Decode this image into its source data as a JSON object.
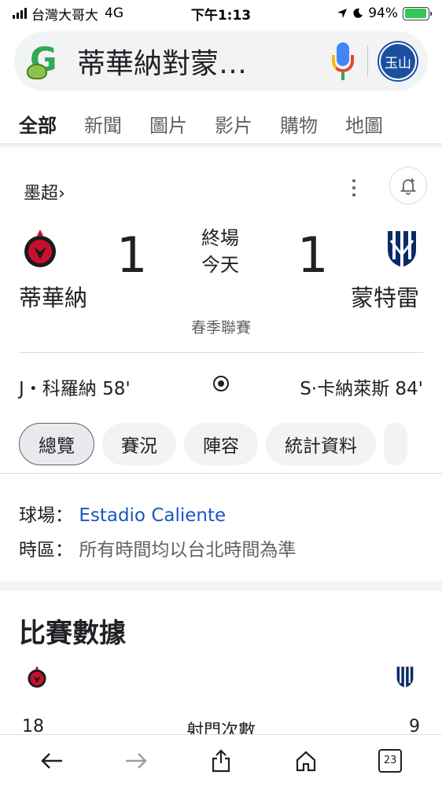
{
  "status_bar": {
    "carrier": "台灣大哥大",
    "network": "4G",
    "time": "下午1:13",
    "battery": "94%",
    "battery_level": 0.94
  },
  "search": {
    "query": "蒂華納對蒙…",
    "avatar_label": "玉山"
  },
  "tabs": [
    {
      "label": "全部",
      "active": true
    },
    {
      "label": "新聞"
    },
    {
      "label": "圖片"
    },
    {
      "label": "影片"
    },
    {
      "label": "購物"
    },
    {
      "label": "地圖"
    }
  ],
  "match": {
    "league": "墨超",
    "home": {
      "name": "蒂華納",
      "score": "1"
    },
    "away": {
      "name": "蒙特雷",
      "score": "1"
    },
    "status": "終場",
    "date": "今天",
    "season": "春季聯賽",
    "home_scorer": "J・科羅納 58'",
    "away_scorer": "S·卡納萊斯 84'"
  },
  "chips": [
    "總覽",
    "賽況",
    "陣容",
    "統計資料"
  ],
  "info": {
    "venue_label": "球場：",
    "venue": "Estadio Caliente",
    "timezone_label": "時區：",
    "timezone": "所有時間均以台北時間為準"
  },
  "stats": {
    "title": "比賽數據",
    "row": {
      "home": "18",
      "label": "射門次數",
      "away": "9"
    }
  },
  "toolbar": {
    "tab_count": "23"
  },
  "colors": {
    "link": "#1a56c4",
    "home_crest": "#c8102e",
    "away_crest": "#0a2a66",
    "battery": "#34c759"
  }
}
